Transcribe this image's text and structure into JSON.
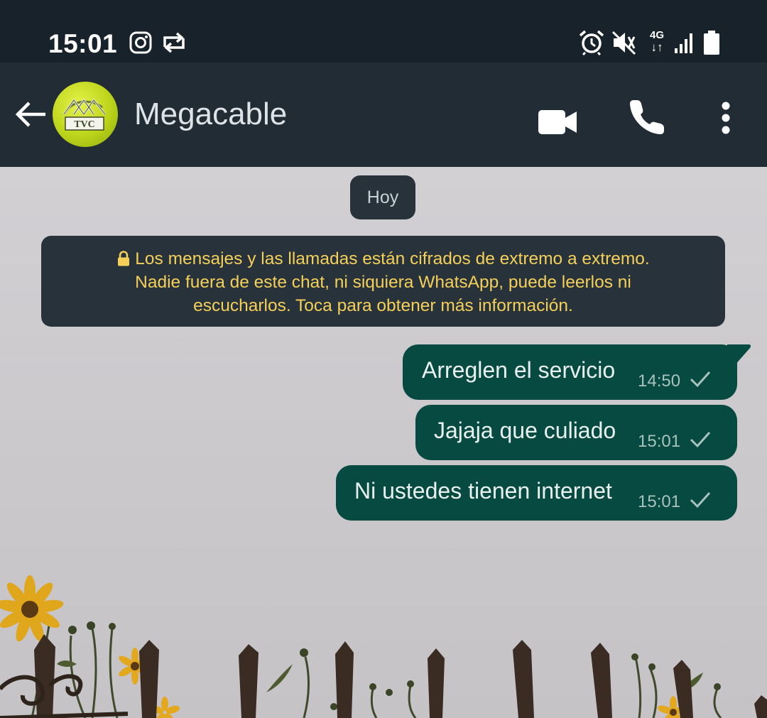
{
  "status_bar": {
    "time": "15:01",
    "network_label": "4G"
  },
  "header": {
    "contact_name": "Megacable",
    "avatar_text": "TVC"
  },
  "chat": {
    "date_chip": "Hoy",
    "encryption_notice": [
      "Los mensajes y las llamadas están cifrados de extremo a extremo.",
      "Nadie fuera de este chat, ni siquiera WhatsApp, puede leerlos ni",
      "escucharlos. Toca para obtener más información."
    ],
    "messages": [
      {
        "text": "Arreglen el servicio",
        "time": "14:50"
      },
      {
        "text": "Jajaja que culiado",
        "time": "15:01"
      },
      {
        "text": "Ni ustedes tienen internet",
        "time": "15:01"
      }
    ]
  },
  "colors": {
    "header_bg": "#222c35",
    "bubble_bg": "#064a42",
    "notice_text": "#f4cf59"
  },
  "icons": [
    "instagram-icon",
    "sync-icon",
    "alarm-icon",
    "vibrate-icon",
    "signal-icon",
    "battery-icon",
    "back-arrow-icon",
    "video-call-icon",
    "phone-icon",
    "more-options-icon",
    "lock-icon",
    "single-check-icon"
  ]
}
